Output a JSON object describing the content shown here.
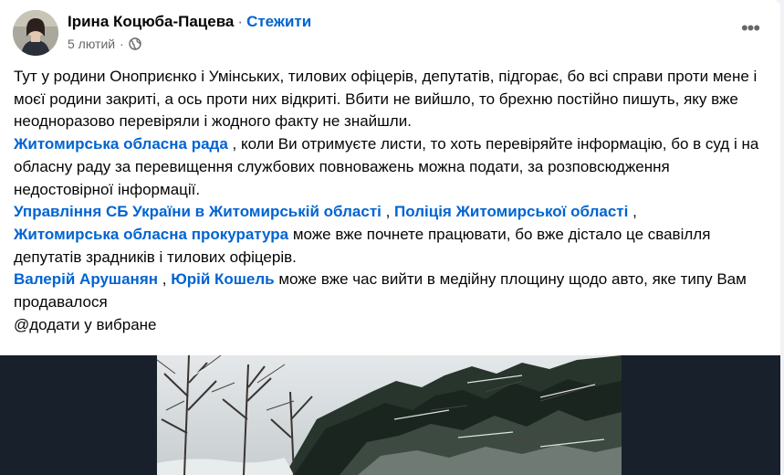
{
  "post": {
    "author": "Ірина Коцюба-Пацева",
    "separator": "·",
    "follow_label": "Стежити",
    "time": "5 лютий",
    "meta_separator": "·",
    "privacy_icon": "globe-icon",
    "more_icon": "more-horizontal-icon",
    "more_glyph": "•••"
  },
  "text": {
    "p1": "Тут у родини Оноприєнко і Умінських, тилових офіцерів, депутатів, підгорає, бо всі справи проти мене і моєї родини закриті, а ось проти них відкриті. Вбити не вийшло, то брехню постійно пишуть, яку вже неодноразово перевіряли і жодного факту не знайшли.",
    "link1": "Житомирська обласна рада",
    "p2_rest": " , коли Ви отримуєте листи, то хоть перевіряйте інформацію, бо в суд і на обласну раду за перевищення службових повноважень можна подати, за розповсюдження недостовірної інформації.",
    "link2": "Управління СБ України в Житомирській області",
    "comma1": " , ",
    "link3": "Поліція Житомирської області",
    "comma2": " ,",
    "link4": "Житомирська обласна прокуратура",
    "p3_rest": " може вже почнете працювати, бо вже дістало це свавілля депутатів зрадників і тилових офіцерів.",
    "link5": "Валерій Арушанян",
    "comma3": " , ",
    "link6": "Юрій Кошель",
    "p4_rest": " може вже час вийти в медійну площину щодо авто, яке типу Вам продавалося",
    "p5": "@додати у вибране"
  },
  "colors": {
    "link": "#0064d1",
    "secondary_text": "#65676b",
    "media_background": "#17202b"
  }
}
